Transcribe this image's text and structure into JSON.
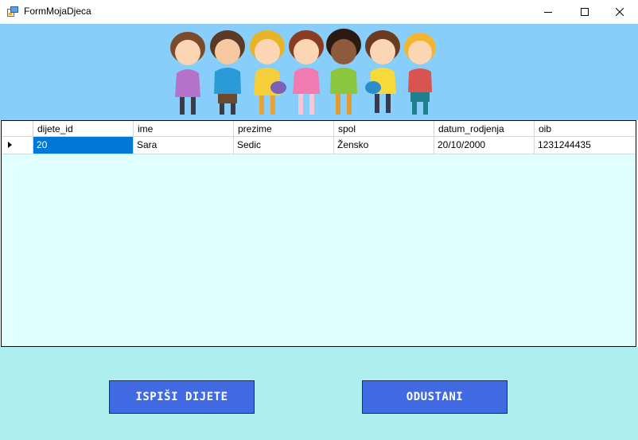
{
  "window": {
    "title": "FormMojaDjeca"
  },
  "grid": {
    "columns": [
      "dijete_id",
      "ime",
      "prezime",
      "spol",
      "datum_rodjenja",
      "oib"
    ],
    "rows": [
      [
        "20",
        "Sara",
        "Sedic",
        "Žensko",
        "20/10/2000",
        "1231244435"
      ]
    ]
  },
  "buttons": {
    "print_label": "ISPIŠI DIJETE",
    "cancel_label": "ODUSTANI"
  },
  "colors": {
    "banner": "#87cefa",
    "grid_bg": "#e0ffff",
    "bottom_bg": "#afeeee",
    "button": "#4169e1",
    "selection": "#0078d7"
  }
}
